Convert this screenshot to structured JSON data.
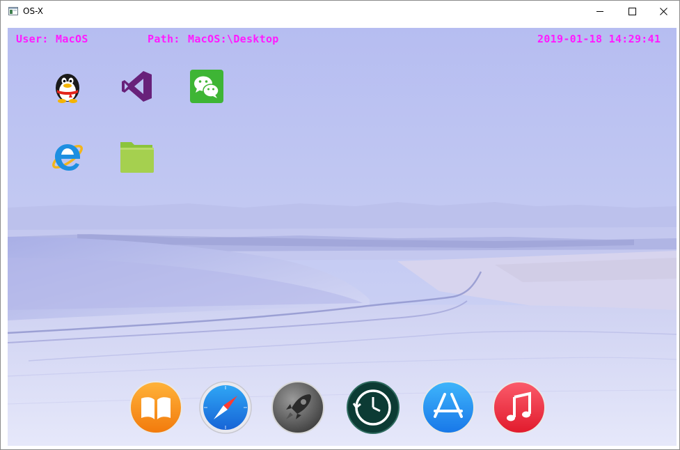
{
  "window": {
    "title": "OS-X"
  },
  "status": {
    "user_label": "User:",
    "user_value": "MacOS",
    "path_label": "Path:",
    "path_value": "MacOS:\\Desktop",
    "datetime": "2019-01-18 14:29:41",
    "color": "#ff1aff"
  },
  "desktop_icons": [
    {
      "icon": "qq-penguin-icon"
    },
    {
      "icon": "visual-studio-icon"
    },
    {
      "icon": "wechat-icon"
    },
    {
      "icon": "internet-explorer-icon"
    },
    {
      "icon": "folder-icon"
    }
  ],
  "dock": [
    {
      "icon": "ibooks-icon"
    },
    {
      "icon": "safari-icon"
    },
    {
      "icon": "launchpad-rocket-icon"
    },
    {
      "icon": "time-machine-icon"
    },
    {
      "icon": "app-store-icon"
    },
    {
      "icon": "itunes-music-icon"
    }
  ]
}
